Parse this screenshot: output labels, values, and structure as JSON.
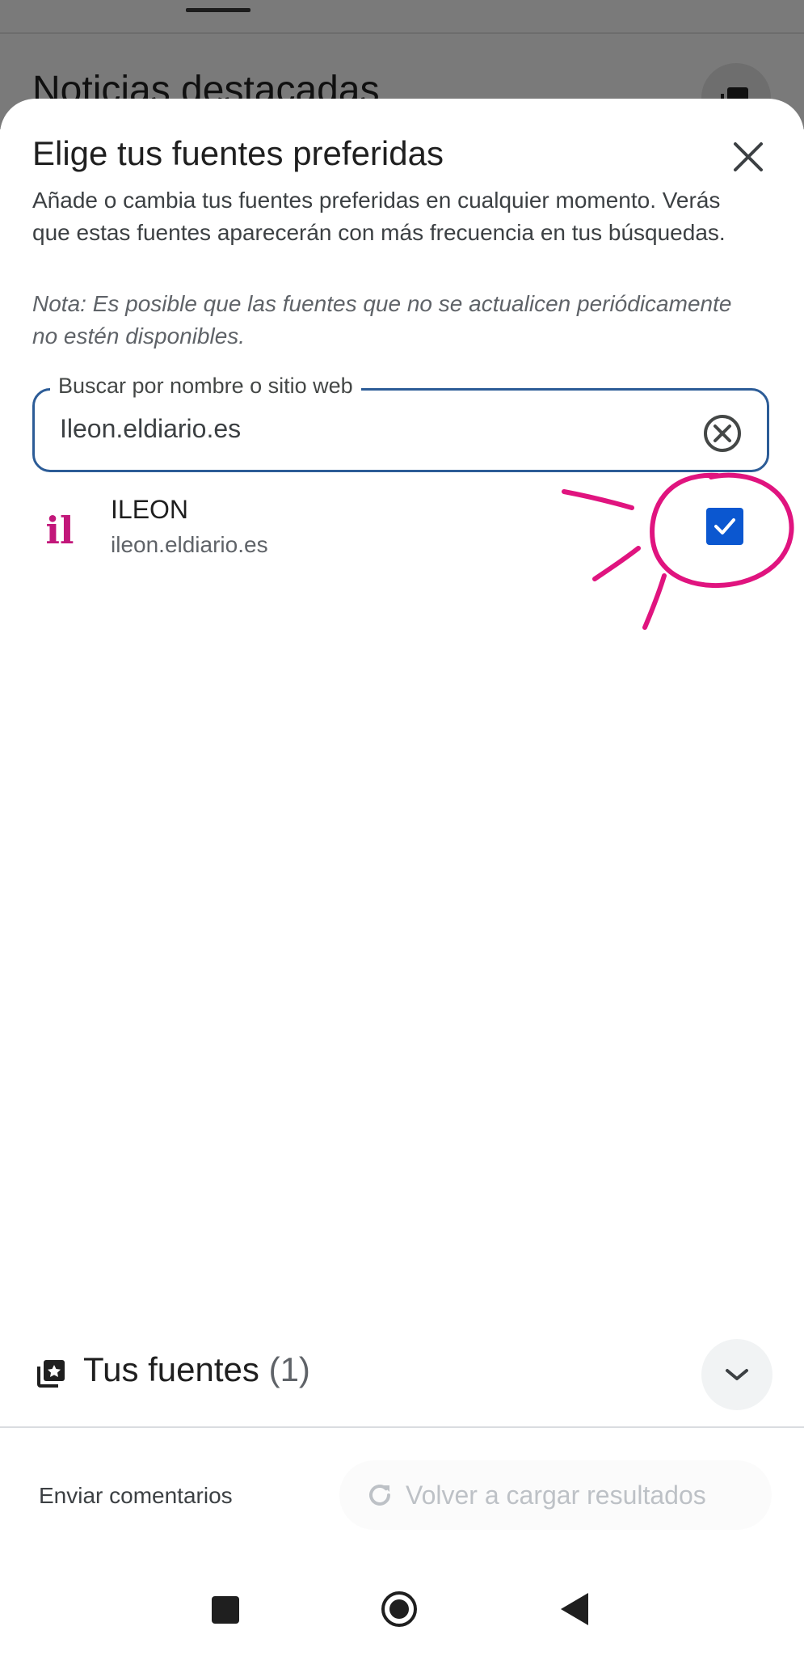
{
  "background": {
    "page_title": "Noticias destacadas"
  },
  "sheet": {
    "title": "Elige tus fuentes preferidas",
    "description": "Añade o cambia tus fuentes preferidas en cualquier momento. Verás que estas fuentes aparecerán con más frecuencia en tus búsquedas.",
    "note": "Nota: Es posible que las fuentes que no se actualicen periódicamente no estén disponibles."
  },
  "search": {
    "label": "Buscar por nombre o sitio web",
    "value": "Ileon.eldiario.es"
  },
  "results": [
    {
      "name": "ILEON",
      "url": "ileon.eldiario.es",
      "logo_text": "il",
      "checked": true
    }
  ],
  "favorites": {
    "title": "Tus fuentes",
    "count": "(1)"
  },
  "footer": {
    "feedback": "Enviar comentarios",
    "reload": "Volver a cargar resultados"
  },
  "colors": {
    "accent_blue": "#0b57d0",
    "search_border": "#2c5c97",
    "annotation_magenta": "#e0147f",
    "logo_magenta": "#c2177a"
  },
  "icons": {
    "close": "close-icon",
    "clear": "clear-circle-icon",
    "favorites": "starred-stack-icon",
    "expand": "chevron-down-icon",
    "reload": "refresh-icon"
  }
}
